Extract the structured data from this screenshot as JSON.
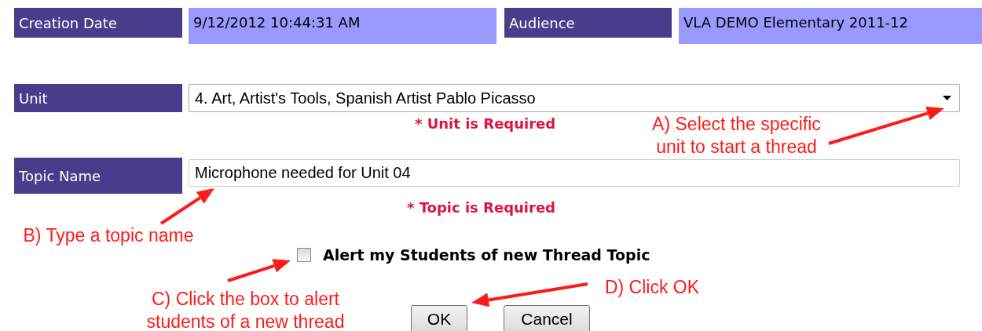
{
  "info_fields": [
    {
      "label": "Creation Date",
      "value": "9/12/2012 10:44:31 AM"
    },
    {
      "label": "Audience",
      "value": "VLA DEMO Elementary 2011-12"
    }
  ],
  "unit": {
    "label": "Unit",
    "value": "4. Art, Artist's Tools, Spanish Artist Pablo Picasso",
    "required_message": "* Unit is Required"
  },
  "topic": {
    "label": "Topic Name",
    "value": "Microphone needed for Unit 04",
    "required_message": "* Topic is Required"
  },
  "alert": {
    "label": "Alert my Students of new Thread Topic",
    "checked": false
  },
  "buttons": [
    "OK",
    "Cancel"
  ],
  "annotations": [
    {
      "text": "A) Select the specific unit to start a thread"
    },
    {
      "text": "B) Type a topic name"
    },
    {
      "text": "C) Click the box to alert students of a new thread"
    },
    {
      "text": "D) Click OK"
    }
  ]
}
